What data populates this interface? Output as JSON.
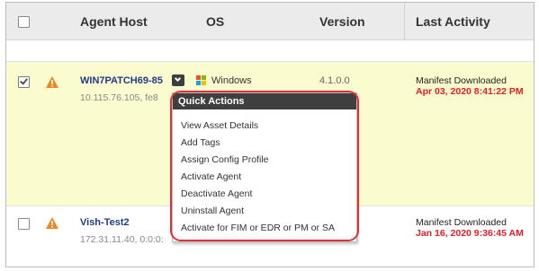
{
  "table": {
    "columns": [
      "Agent Host",
      "OS",
      "Version",
      "Last Activity"
    ]
  },
  "rows": [
    {
      "checked": true,
      "host": "WIN7PATCH69-85",
      "ip": "10.115.76.105, fe8",
      "os": "Windows",
      "version": "4.1.0.0",
      "activity": "Manifest Downloaded",
      "activity_date": "Apr 03, 2020 8:41:22 PM"
    },
    {
      "checked": false,
      "host": "Vish-Test2",
      "ip": "172.31.11.40, 0:0:0:",
      "activity": "Manifest Downloaded",
      "activity_date": "Jan 16, 2020 9:36:45 AM"
    }
  ],
  "quick_actions": {
    "title": "Quick Actions",
    "items": [
      "View Asset Details",
      "Add Tags",
      "Assign Config Profile",
      "Activate Agent",
      "Deactivate Agent",
      "Uninstall Agent",
      "Activate for FIM or EDR or PM or SA"
    ]
  },
  "icons": {
    "warning": "warning-triangle-icon",
    "os": "windows-logo-icon",
    "dropdown": "chevron-down-icon"
  },
  "colors": {
    "header_bg": "#ebebeb",
    "selected_row_bg": "#fbfbd0",
    "host_link": "#1f3c88",
    "date_red": "#e31e24",
    "warning_orange": "#f0861e",
    "menu_header_bg": "#3f3f3f",
    "highlight_border": "#e0303a"
  }
}
